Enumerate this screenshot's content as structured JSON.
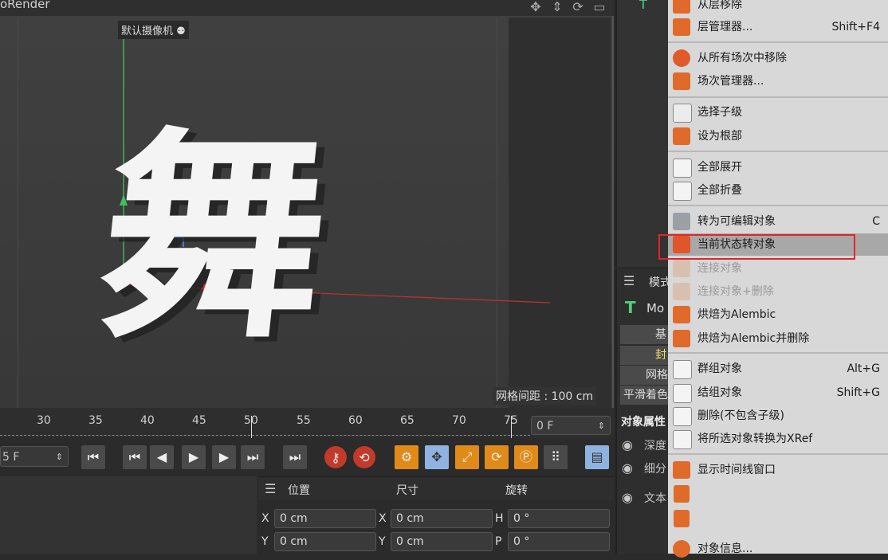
{
  "viewport": {
    "title_fragment": "oRender",
    "camera_label": "默认摄像机",
    "grid_spacing": "网格间距 : 100 cm",
    "text_object": "舞",
    "nav_icons": [
      "move-view-icon",
      "zoom-view-icon",
      "rotate-view-icon",
      "maximize-view-icon"
    ]
  },
  "timeline": {
    "ticks": [
      "30",
      "35",
      "40",
      "45",
      "50",
      "55",
      "60",
      "65",
      "70",
      "75"
    ],
    "end_frame": "0 F",
    "current_frame": "5 F"
  },
  "coordinates": {
    "headers": [
      "位置",
      "尺寸",
      "旋转"
    ],
    "rows": [
      {
        "a1": "X",
        "v1": "0 cm",
        "a2": "X",
        "v2": "0 cm",
        "a3": "H",
        "v3": "0 °"
      },
      {
        "a1": "Y",
        "v1": "0 cm",
        "a2": "Y",
        "v2": "0 cm",
        "a3": "P",
        "v3": "0 °"
      }
    ]
  },
  "attributes": {
    "mode_label": "模式",
    "object_name": "Mo",
    "tabs": [
      "基",
      "封",
      "网格",
      "平滑着色"
    ],
    "section_title": "对象属性",
    "radio_items": [
      "深度",
      "细分",
      "文本"
    ]
  },
  "menu": {
    "items": [
      {
        "label": "从层移除",
        "shortcut": "",
        "disabled": false
      },
      {
        "label": "层管理器...",
        "shortcut": "Shift+F4",
        "disabled": false
      },
      {
        "label": "从所有场次中移除",
        "shortcut": "",
        "disabled": false
      },
      {
        "label": "场次管理器...",
        "shortcut": "",
        "disabled": false
      },
      {
        "label": "选择子级",
        "shortcut": "",
        "disabled": false
      },
      {
        "label": "设为根部",
        "shortcut": "",
        "disabled": false
      },
      {
        "label": "全部展开",
        "shortcut": "",
        "disabled": false
      },
      {
        "label": "全部折叠",
        "shortcut": "",
        "disabled": false
      },
      {
        "label": "转为可编辑对象",
        "shortcut": "C",
        "disabled": false
      },
      {
        "label": "当前状态转对象",
        "shortcut": "",
        "disabled": false,
        "highlighted": true
      },
      {
        "label": "连接对象",
        "shortcut": "",
        "disabled": true
      },
      {
        "label": "连接对象+删除",
        "shortcut": "",
        "disabled": true
      },
      {
        "label": "烘焙为Alembic",
        "shortcut": "",
        "disabled": false
      },
      {
        "label": "烘焙为Alembic并删除",
        "shortcut": "",
        "disabled": false
      },
      {
        "label": "群组对象",
        "shortcut": "Alt+G",
        "disabled": false
      },
      {
        "label": "结组对象",
        "shortcut": "Shift+G",
        "disabled": false
      },
      {
        "label": "删除(不包含子级)",
        "shortcut": "",
        "disabled": false
      },
      {
        "label": "将所选对象转换为XRef",
        "shortcut": "",
        "disabled": false
      },
      {
        "label": "显示时间线窗口",
        "shortcut": "",
        "disabled": false
      },
      {
        "label": "对象信息...",
        "shortcut": "",
        "disabled": false
      }
    ]
  },
  "colors": {
    "accent_red": "#e0262a",
    "transport_red": "#c23a2a",
    "tool_orange": "#e08a1a",
    "menu_bg": "#d8d8d8",
    "text_green": "#4fd07a"
  }
}
